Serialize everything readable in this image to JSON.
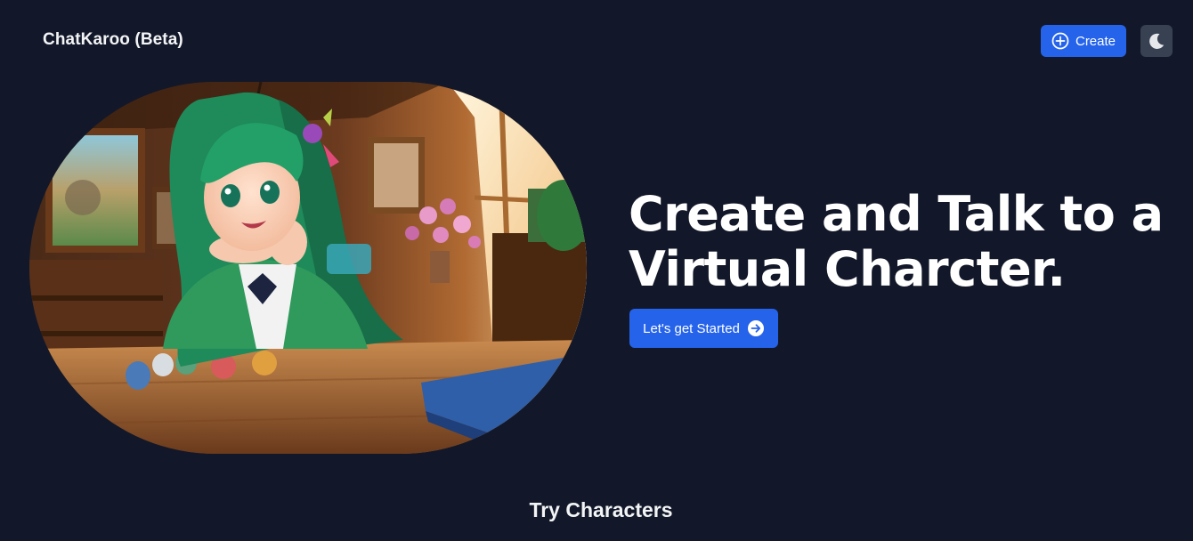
{
  "header": {
    "brand": "ChatKaroo (Beta)",
    "create_label": "Create",
    "theme_icon": "moon-icon"
  },
  "hero": {
    "title": "Create and Talk to a Virtual Charcter.",
    "cta_label": "Let's get Started",
    "cta_icon": "arrow-right-circle-icon",
    "image_alt": "Anime girl with green hair at a wooden table"
  },
  "characters": {
    "heading": "Try Characters"
  },
  "colors": {
    "background": "#121829",
    "accent": "#2563eb",
    "theme_button": "#374151"
  }
}
